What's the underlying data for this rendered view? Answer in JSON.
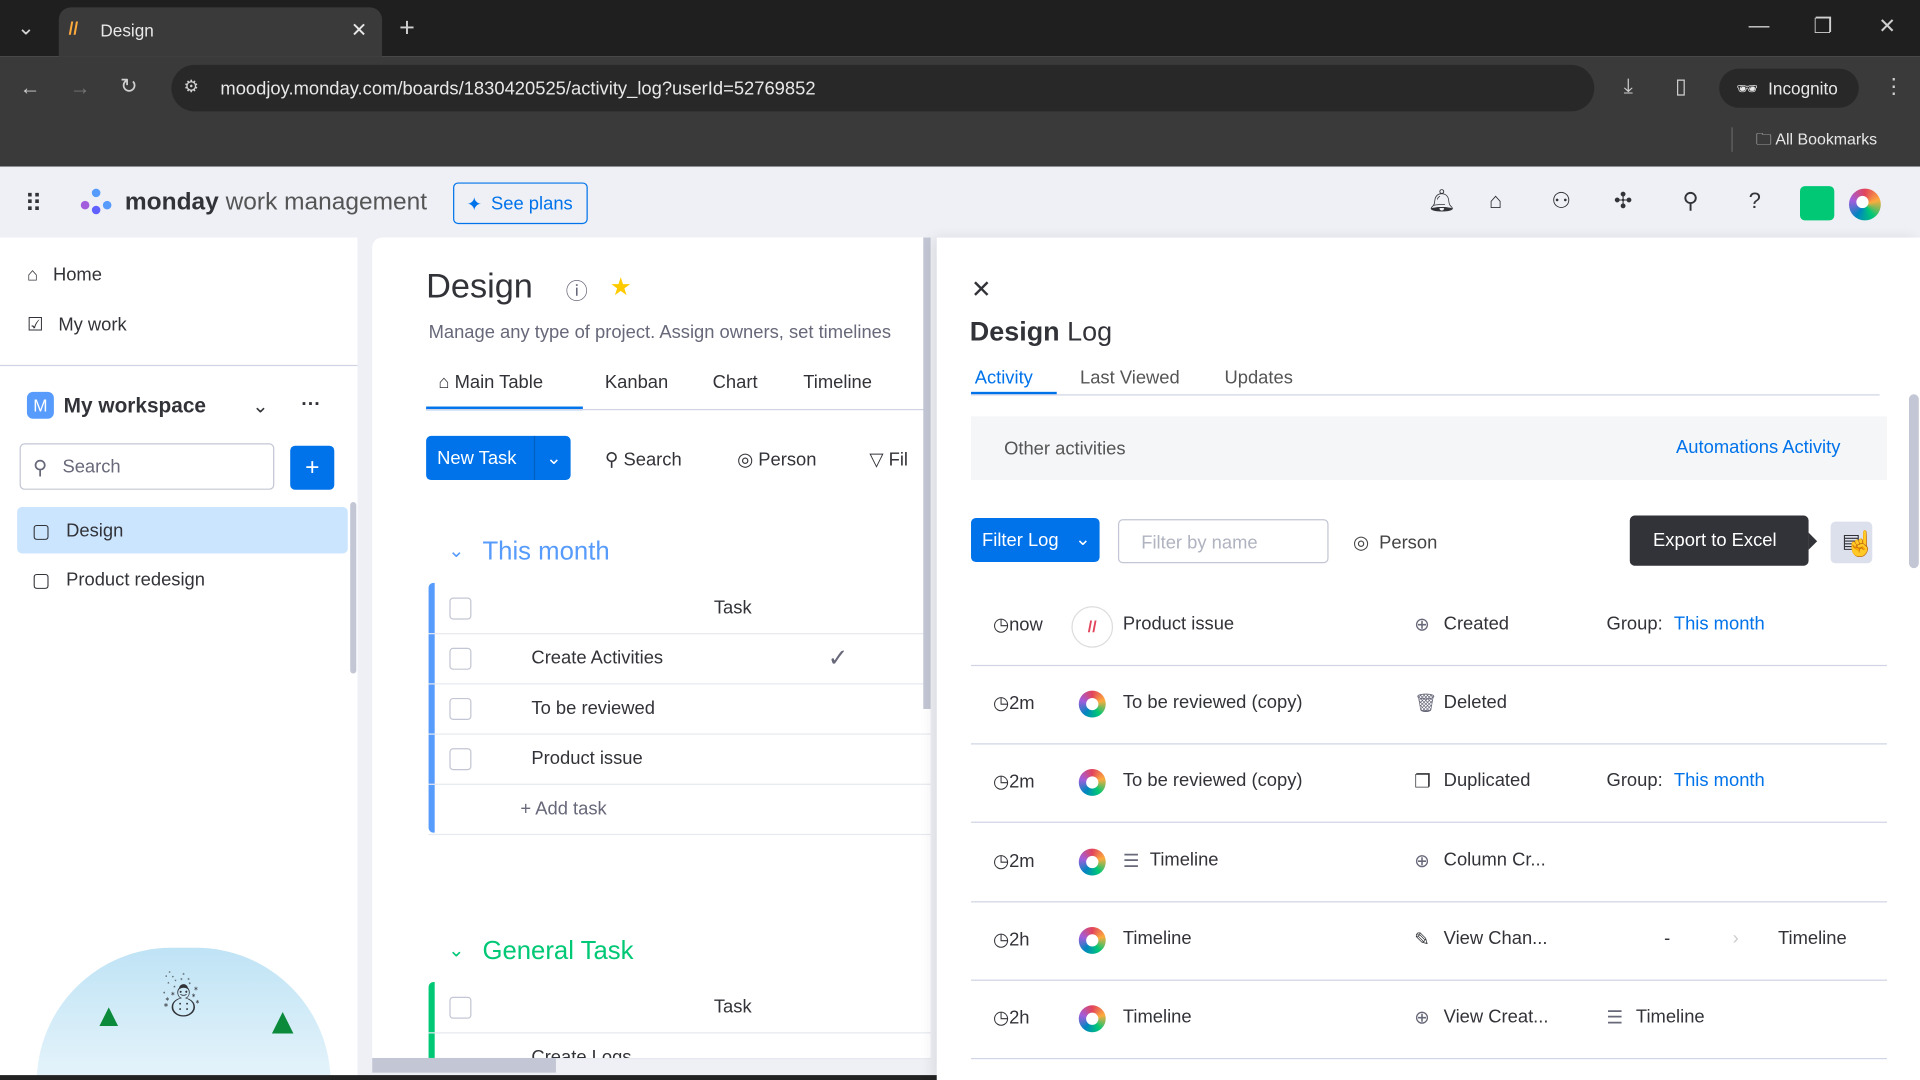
{
  "browser": {
    "tab_title": "Design",
    "url": "moodjoy.monday.com/boards/1830420525/activity_log?userId=52769852",
    "profile": "Incognito",
    "bookmarks": "All Bookmarks"
  },
  "header": {
    "brand": "monday",
    "brand_sub": "work management",
    "see_plans": "See plans"
  },
  "sidebar": {
    "home": "Home",
    "my_work": "My work",
    "workspace": "My workspace",
    "workspace_initial": "M",
    "search_placeholder": "Search",
    "boards": [
      {
        "label": "Design"
      },
      {
        "label": "Product redesign"
      }
    ]
  },
  "board": {
    "title": "Design",
    "description": "Manage any type of project. Assign owners, set timelines",
    "views": [
      "Main Table",
      "Kanban",
      "Chart",
      "Timeline"
    ],
    "new_task": "New Task",
    "search": "Search",
    "person": "Person",
    "filter": "Fil",
    "groups": [
      {
        "name": "This month",
        "color": "#579bfc",
        "column": "Task",
        "tasks": [
          "Create Activities",
          "To be reviewed",
          "Product issue"
        ],
        "add_task": "+ Add task"
      },
      {
        "name": "General Task",
        "color": "#00c875",
        "column": "Task",
        "tasks": [
          "Create Logs"
        ]
      }
    ]
  },
  "log": {
    "title_bold": "Design",
    "title": "Log",
    "tabs": [
      "Activity",
      "Last Viewed",
      "Updates"
    ],
    "other_activities": "Other activities",
    "automations": "Automations Activity",
    "filter_log": "Filter Log",
    "filter_placeholder": "Filter by name",
    "person": "Person",
    "export_tooltip": "Export to Excel",
    "rows": [
      {
        "time": "now",
        "item": "Product issue",
        "action": "Created",
        "action_icon": "plus-circle",
        "label": "Group:",
        "value": "This month",
        "avatar": "monday-logo"
      },
      {
        "time": "2m",
        "item": "To be reviewed (copy)",
        "action": "Deleted",
        "action_icon": "trash"
      },
      {
        "time": "2m",
        "item": "To be reviewed (copy)",
        "action": "Duplicated",
        "action_icon": "duplicate",
        "label": "Group:",
        "value": "This month"
      },
      {
        "time": "2m",
        "item": "Timeline",
        "item_icon": "timeline",
        "action": "Column Cr...",
        "action_icon": "plus-circle"
      },
      {
        "time": "2h",
        "item": "Timeline",
        "action": "View Chan...",
        "action_icon": "pencil",
        "from": "-",
        "to": "Timeline"
      },
      {
        "time": "2h",
        "item": "Timeline",
        "action": "View Creat...",
        "action_icon": "plus-circle",
        "value": "Timeline",
        "value_icon": "timeline"
      }
    ]
  },
  "colors": {
    "accent": "#0073ea",
    "this_month": "#579bfc",
    "general": "#00c875"
  }
}
